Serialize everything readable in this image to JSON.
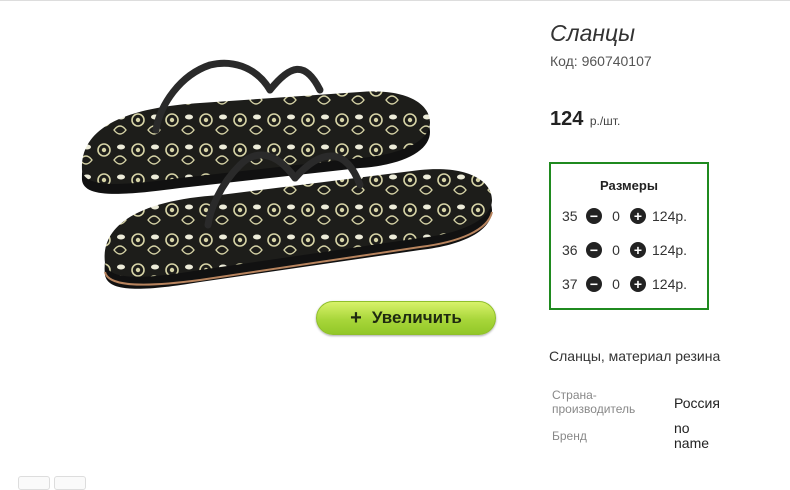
{
  "product": {
    "title": "Сланцы",
    "code": "Код: 960740107",
    "price": "124",
    "price_unit": "р./шт.",
    "zoom_label": "Увеличить",
    "description": "Сланцы, материал резина"
  },
  "sizes": {
    "header": "Размеры",
    "rows": [
      {
        "size": "35",
        "qty": "0",
        "price": "124р."
      },
      {
        "size": "36",
        "qty": "0",
        "price": "124р."
      },
      {
        "size": "37",
        "qty": "0",
        "price": "124р."
      }
    ]
  },
  "specs": [
    {
      "label": "Страна-производитель",
      "value": "Россия"
    },
    {
      "label": "Бренд",
      "value": "no name"
    }
  ],
  "colors": {
    "accent_border": "#1f8a1f",
    "zoom_button": "#a8d63a"
  }
}
